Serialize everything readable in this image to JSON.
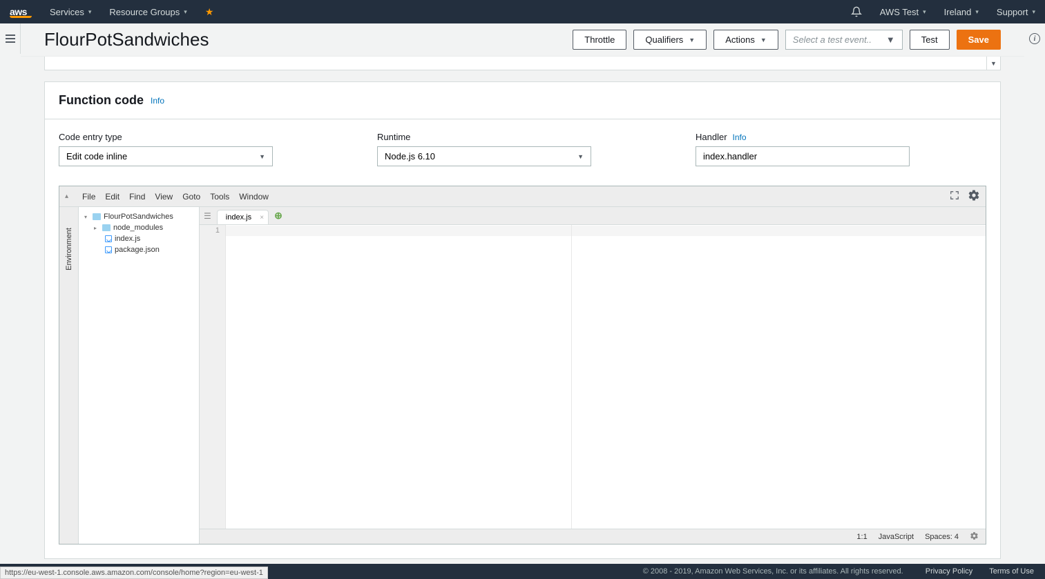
{
  "nav": {
    "logo": "aws",
    "services": "Services",
    "resource_groups": "Resource Groups",
    "account": "AWS Test",
    "region": "Ireland",
    "support": "Support"
  },
  "header": {
    "title": "FlourPotSandwiches",
    "throttle": "Throttle",
    "qualifiers": "Qualifiers",
    "actions": "Actions",
    "test_event_placeholder": "Select a test event..",
    "test": "Test",
    "save": "Save"
  },
  "function_code": {
    "panel_title": "Function code",
    "info": "Info",
    "code_entry_label": "Code entry type",
    "code_entry_value": "Edit code inline",
    "runtime_label": "Runtime",
    "runtime_value": "Node.js 6.10",
    "handler_label": "Handler",
    "handler_info": "Info",
    "handler_value": "index.handler"
  },
  "editor": {
    "menu": {
      "file": "File",
      "edit": "Edit",
      "find": "Find",
      "view": "View",
      "goto": "Goto",
      "tools": "Tools",
      "window": "Window"
    },
    "env_label": "Environment",
    "tree": {
      "root": "FlourPotSandwiches",
      "node_modules": "node_modules",
      "index_js": "index.js",
      "package_json": "package.json"
    },
    "tab": "index.js",
    "line1": "1",
    "status": {
      "pos": "1:1",
      "lang": "JavaScript",
      "spaces": "Spaces: 4"
    }
  },
  "footer": {
    "copyright": "© 2008 - 2019, Amazon Web Services, Inc. or its affiliates. All rights reserved.",
    "privacy": "Privacy Policy",
    "terms": "Terms of Use"
  },
  "status_url": "https://eu-west-1.console.aws.amazon.com/console/home?region=eu-west-1"
}
